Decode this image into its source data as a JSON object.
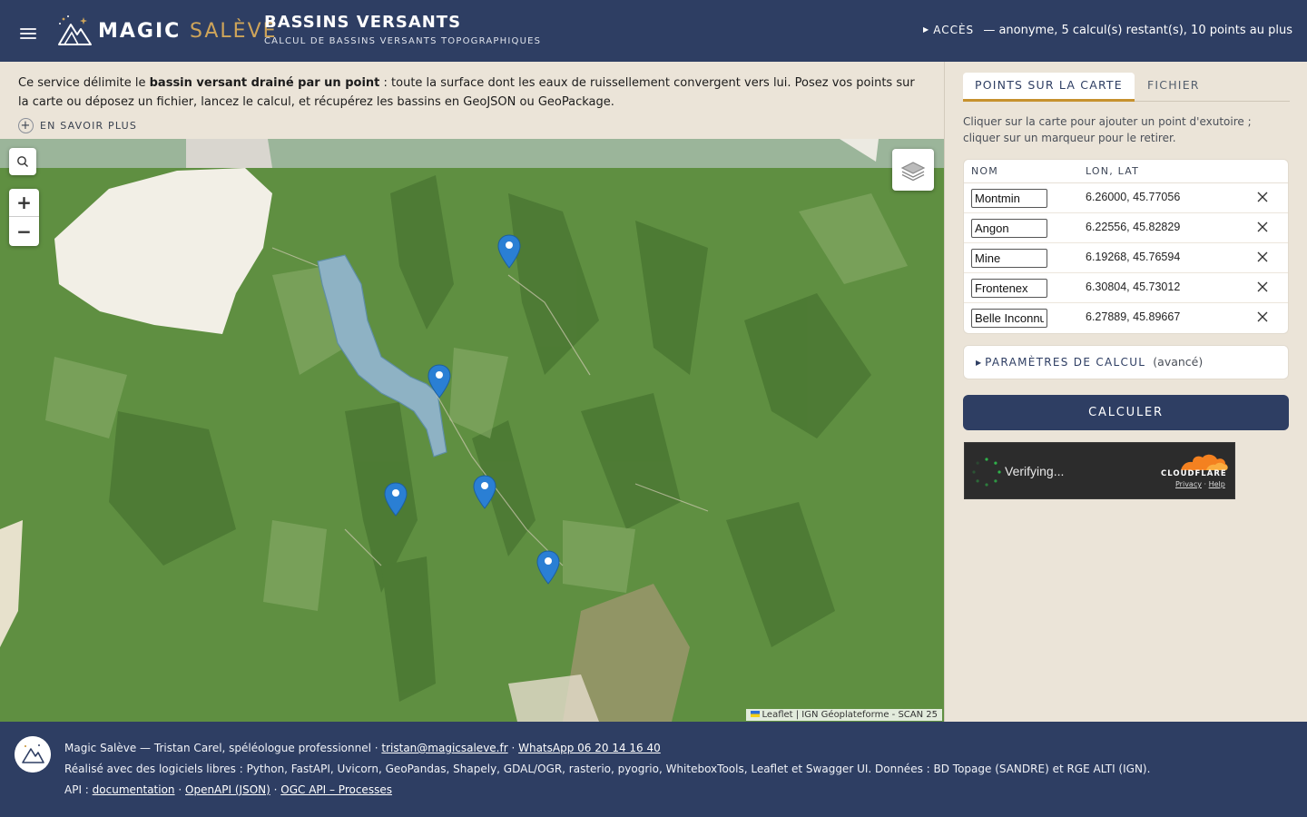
{
  "header": {
    "brand_part1": "MAGIC",
    "brand_part2": "SALÈVE",
    "title": "BASSINS VERSANTS",
    "subtitle": "CALCUL DE BASSINS VERSANTS TOPOGRAPHIQUES",
    "access_label": "ACCÈS",
    "access_status": "— anonyme, 5 calcul(s) restant(s), 10 points au plus"
  },
  "intro": {
    "text_before": "Ce service délimite le ",
    "text_bold": "bassin versant drainé par un point",
    "text_after": " : toute la surface dont les eaux de ruissellement convergent vers lui. Posez vos points sur la carte ou déposez un fichier, lancez le calcul, et récupérez les bassins en GeoJSON ou GeoPackage.",
    "learn_more": "EN SAVOIR PLUS"
  },
  "map": {
    "zoom_in": "+",
    "zoom_out": "−",
    "attribution_leaflet": "Leaflet",
    "attribution_rest": " | IGN Géoplateforme - SCAN 25",
    "marker_count": 5
  },
  "sidebar": {
    "tabs": [
      {
        "label": "POINTS SUR LA CARTE",
        "active": true
      },
      {
        "label": "FICHIER",
        "active": false
      }
    ],
    "help_text": "Cliquer sur la carte pour ajouter un point d'exutoire ; cliquer sur un marqueur pour le retirer.",
    "table": {
      "col_name": "NOM",
      "col_coords": "LON, LAT",
      "rows": [
        {
          "name": "Montmin",
          "coords": "6.26000, 45.77056"
        },
        {
          "name": "Angon",
          "coords": "6.22556, 45.82829"
        },
        {
          "name": "Mine",
          "coords": "6.19268, 45.76594"
        },
        {
          "name": "Frontenex",
          "coords": "6.30804, 45.73012"
        },
        {
          "name": "Belle Inconnue",
          "coords": "6.27889, 45.89667"
        }
      ]
    },
    "params_label": "PARAMÈTRES DE CALCUL",
    "params_advanced": "(avancé)",
    "calc_button": "CALCULER",
    "captcha": {
      "status": "Verifying...",
      "brand": "CLOUDFLARE",
      "privacy": "Privacy",
      "separator": " · ",
      "help": "Help"
    }
  },
  "footer": {
    "line1_text": "Magic Salève — Tristan Carel, spéléologue professionnel · ",
    "email": "tristan@magicsaleve.fr",
    "dot": " · ",
    "whatsapp": "WhatsApp 06 20 14 16 40",
    "line2": "Réalisé avec des logiciels libres : Python, FastAPI, Uvicorn, GeoPandas, Shapely, GDAL/OGR, rasterio, pyogrio, WhiteboxTools, Leaflet et Swagger UI. Données : BD Topage (SANDRE) et RGE ALTI (IGN).",
    "api_label": "API : ",
    "link_docs": "documentation",
    "link_openapi": "OpenAPI (JSON)",
    "link_ogc": "OGC API – Processes"
  },
  "colors": {
    "header_bg": "#2e3e63",
    "accent_gold": "#c6912e",
    "page_bg": "#ebe4d8",
    "marker_blue": "#2a7fd4"
  }
}
